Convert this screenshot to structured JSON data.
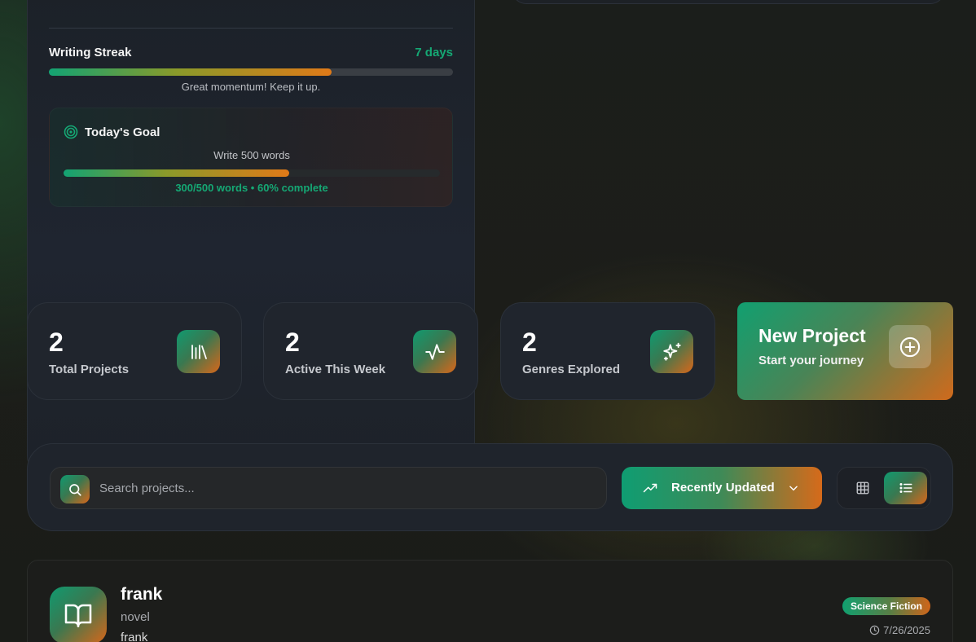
{
  "streak": {
    "label": "Writing Streak",
    "value": "7 days",
    "progress": 0.7,
    "message": "Great momentum! Keep it up."
  },
  "goal": {
    "title": "Today's Goal",
    "description": "Write 500 words",
    "progress": 0.6,
    "status": "300/500 words • 60% complete"
  },
  "stats": [
    {
      "value": "2",
      "label": "Total Projects",
      "icon": "library-icon"
    },
    {
      "value": "2",
      "label": "Active This Week",
      "icon": "activity-icon"
    },
    {
      "value": "2",
      "label": "Genres Explored",
      "icon": "sparkles-icon"
    }
  ],
  "new_project": {
    "title": "New Project",
    "subtitle": "Start your journey",
    "icon": "plus-circle-icon"
  },
  "toolbar": {
    "search_placeholder": "Search projects...",
    "search_value": "",
    "sort_label": "Recently Updated",
    "view_modes": [
      "grid",
      "list"
    ],
    "active_view": "list"
  },
  "projects": [
    {
      "title": "frank",
      "type": "novel",
      "description": "frank",
      "genre": "Science Fiction",
      "updated": "7/26/2025"
    }
  ],
  "colors": {
    "accent_green": "#13a373",
    "accent_orange": "#e07a18",
    "panel": "#1f242c"
  }
}
